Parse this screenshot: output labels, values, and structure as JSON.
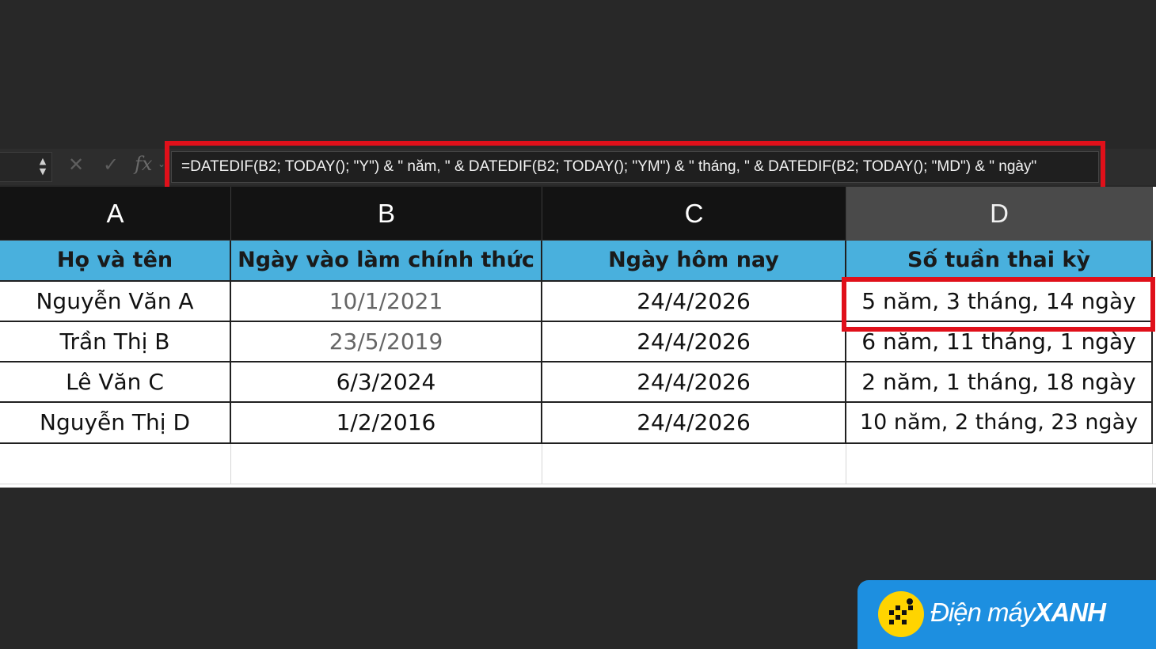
{
  "formula_bar": {
    "stepper_up": "▲",
    "stepper_down": "▼",
    "cancel_icon": "✕",
    "enter_icon": "✓",
    "fx_label": "fx",
    "fx_caret": "⌄",
    "formula": "=DATEDIF(B2; TODAY(); \"Y\") & \" năm, \" & DATEDIF(B2; TODAY(); \"YM\") & \" tháng, \" & DATEDIF(B2; TODAY(); \"MD\") & \" ngày\""
  },
  "columns": [
    "A",
    "B",
    "C",
    "D"
  ],
  "selected_column": "D",
  "table": {
    "headers": [
      "Họ và tên",
      "Ngày vào làm chính thức",
      "Ngày hôm nay",
      "Số tuần thai kỳ"
    ],
    "rows": [
      [
        "Nguyễn Văn A",
        "10/1/2021",
        "24/4/2026",
        "5 năm, 3 tháng, 14 ngày"
      ],
      [
        "Trần Thị B",
        "23/5/2019",
        "24/4/2026",
        "6 năm, 11 tháng, 1 ngày"
      ],
      [
        "Lê Văn C",
        "6/3/2024",
        "24/4/2026",
        "2 năm, 1 tháng, 18 ngày"
      ],
      [
        "Nguyễn Thị D",
        "1/2/2016",
        "24/4/2026",
        "10 năm, 2 tháng, 23 ngày"
      ]
    ]
  },
  "highlight_color": "#e0101a",
  "header_fill": "#49b0dd",
  "logo": {
    "name_part1": "Điện máy",
    "name_part2": "XANH",
    "color": "#1d8fe0"
  }
}
